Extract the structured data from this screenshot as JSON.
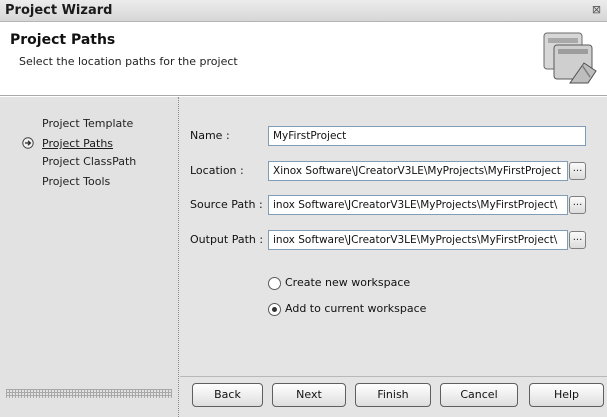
{
  "window": {
    "title": "Project Wizard",
    "close_glyph": "⊠"
  },
  "header": {
    "title": "Project Paths",
    "subtitle": "Select the location paths for the project",
    "icon": "wizard-windows-icon"
  },
  "steps": [
    {
      "label": "Project Template",
      "active": false
    },
    {
      "label": "Project Paths",
      "active": true
    },
    {
      "label": "Project ClassPath",
      "active": false
    },
    {
      "label": "Project Tools",
      "active": false
    }
  ],
  "fields": {
    "name": {
      "label": "Name :",
      "value": "MyFirstProject"
    },
    "location": {
      "label": "Location :",
      "value": "Xinox Software\\JCreatorV3LE\\MyProjects\\MyFirstProject"
    },
    "source": {
      "label": "Source Path :",
      "value": "inox Software\\JCreatorV3LE\\MyProjects\\MyFirstProject\\"
    },
    "output": {
      "label": "Output Path :",
      "value": "inox Software\\JCreatorV3LE\\MyProjects\\MyFirstProject\\"
    },
    "browse_label": "..."
  },
  "workspace": {
    "options": [
      {
        "label": "Create new workspace",
        "selected": false
      },
      {
        "label": "Add to current workspace",
        "selected": true
      }
    ]
  },
  "buttons": {
    "back": "Back",
    "next": "Next",
    "finish": "Finish",
    "cancel": "Cancel",
    "help": "Help"
  },
  "colors": {
    "panel_bg": "#e4e4e4",
    "header_bg": "#ffffff",
    "field_border": "#7f9db9"
  }
}
